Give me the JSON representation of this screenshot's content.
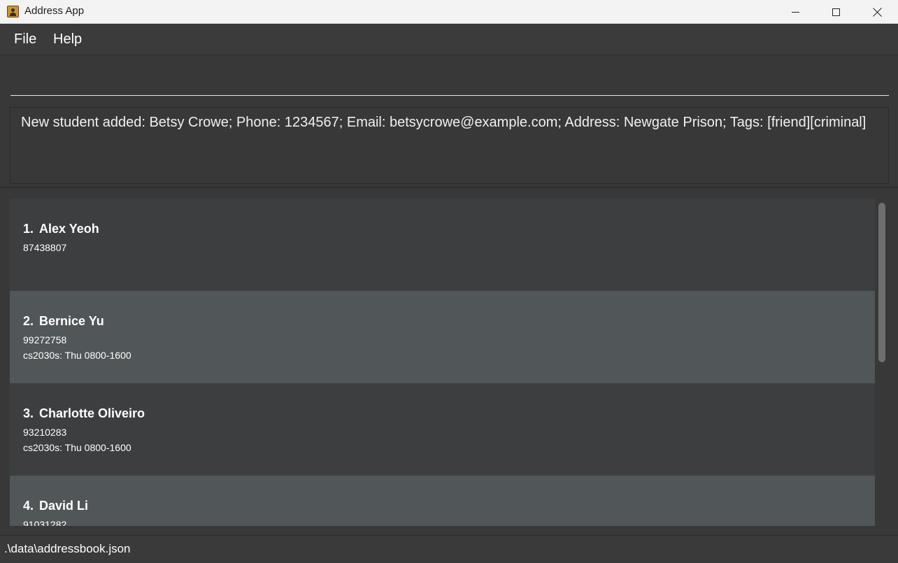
{
  "window": {
    "title": "Address App"
  },
  "menu": {
    "file": "File",
    "help": "Help"
  },
  "command": {
    "value": "",
    "placeholder": ""
  },
  "result": {
    "text": "New student added: Betsy Crowe; Phone: 1234567; Email: betsycrowe@example.com; Address: Newgate Prison; Tags: [friend][criminal]"
  },
  "students": [
    {
      "index": "1.",
      "name": "Alex Yeoh",
      "phone": "87438807",
      "slot": ""
    },
    {
      "index": "2.",
      "name": "Bernice Yu",
      "phone": "99272758",
      "slot": "cs2030s: Thu 0800-1600"
    },
    {
      "index": "3.",
      "name": "Charlotte Oliveiro",
      "phone": "93210283",
      "slot": "cs2030s: Thu 0800-1600"
    },
    {
      "index": "4.",
      "name": "David Li",
      "phone": "91031282",
      "slot": ""
    }
  ],
  "status": {
    "path": ".\\data\\addressbook.json"
  },
  "colors": {
    "background": "#383838",
    "card_odd": "#3c3e3f",
    "card_even": "#515658",
    "text": "#ffffff"
  }
}
